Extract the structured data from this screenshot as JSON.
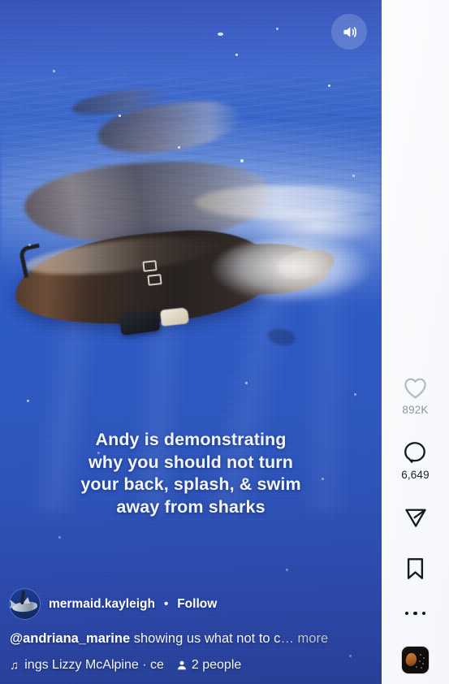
{
  "video": {
    "mute_button": {
      "icon": "speaker-on-icon",
      "label": "Audio"
    },
    "burned_caption_lines": [
      "Andy is demonstrating",
      "why you should not turn",
      "your back, splash, & swim",
      "away from sharks"
    ]
  },
  "post": {
    "avatar_alt": "mermaid.kayleigh profile picture",
    "username": "mermaid.kayleigh",
    "separator": "•",
    "follow_label": "Follow",
    "caption_mention": "@andriana_marine",
    "caption_text": " showing us what not to c",
    "caption_more": "… more",
    "audio": {
      "note_icon": "music-note-icon",
      "track_text": "ings  Lizzy McAlpine · ce",
      "people_icon": "person-icon",
      "people_label": "2 people"
    }
  },
  "rail": {
    "like": {
      "icon": "heart-icon",
      "count": "892K"
    },
    "comment": {
      "icon": "comment-bubble-icon",
      "count": "6,649"
    },
    "share": {
      "icon": "paper-plane-icon"
    },
    "save": {
      "icon": "bookmark-icon"
    },
    "more": {
      "icon": "more-horizontal-icon"
    },
    "thumbnail": {
      "alt": "audio track thumbnail"
    }
  },
  "colors": {
    "water_deep": "#2849b1",
    "water_surface": "#3f69d2",
    "rail_bg": "#f2f5fb",
    "like_count": "#8e949e",
    "comment_count": "#20242b",
    "caption_more": "#b9c4d6"
  }
}
